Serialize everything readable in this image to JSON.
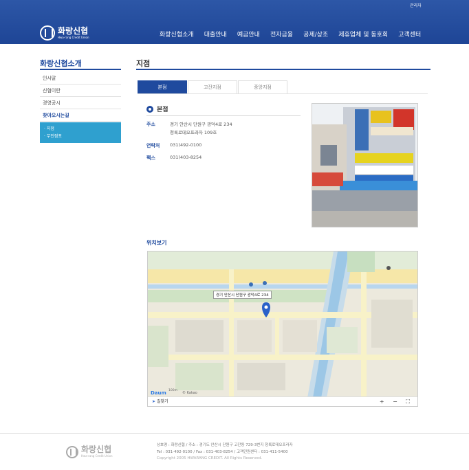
{
  "header": {
    "admin_link": "관리자",
    "logo_name": "화랑신협",
    "logo_sub": "Hwa-rang Credit Union",
    "nav": [
      "화랑신협소개",
      "대출안내",
      "예금안내",
      "전자금융",
      "공제/상조",
      "제휴업체 및 동호회",
      "고객센터"
    ]
  },
  "sidebar": {
    "title": "화랑신협소개",
    "items": [
      "인사말",
      "신협이란",
      "경영공시",
      "찾아오시는길"
    ],
    "sub_items": [
      "· 지점",
      "· 무인점포"
    ]
  },
  "main": {
    "title": "지점",
    "tabs": [
      "본점",
      "고잔지점",
      "중앙지점"
    ],
    "branch": {
      "name": "본점",
      "address_label": "주소",
      "address_line1": "경기 안산시 단원구 광덕4로 234",
      "address_line2": "청록로데오프라자 109호",
      "phone_label": "연락처",
      "phone": "031)492-0100",
      "fax_label": "팩스",
      "fax": "031)403-8254"
    },
    "map": {
      "title": "위치보기",
      "callout": "경기 안산시 단원구 광덕4로 234",
      "route_label": "길찾기",
      "controls": "+ − ⛶",
      "brand": "Daum",
      "credit": "© Kakao",
      "scale": "100m"
    }
  },
  "footer": {
    "logo_name": "화랑신협",
    "logo_sub": "Hwa-rang Credit Union",
    "line1": "상호명 : 화랑신협 / 주소 : 경기도 안산시 단원구 고잔동 729-3번지 청록로데오프라자",
    "line2": "Tel : 031-492-0100 / Fax : 031-403-8254 / 고객민원센터 : 031-411-5400",
    "copyright": "Copyright 2005 HWARANG CREDIT. All Rights Reserved."
  },
  "colors": {
    "brand_blue": "#1f4a9e",
    "header_blue": "#2d57a7",
    "submenu_cyan": "#2fa0cf"
  }
}
